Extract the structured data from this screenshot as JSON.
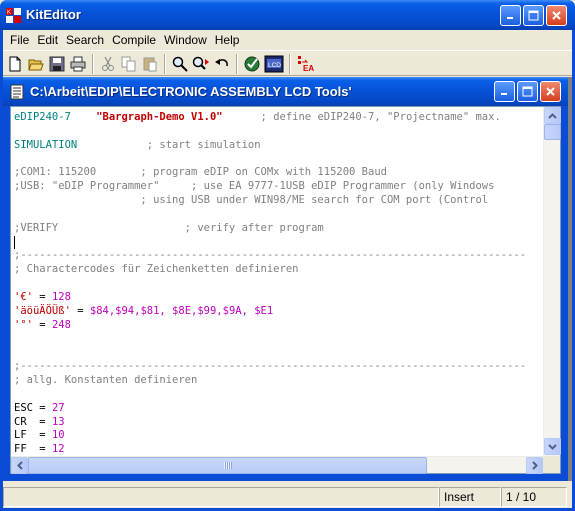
{
  "app": {
    "title": "KitEditor",
    "icon": "kiteditor-app-icon"
  },
  "menu": [
    {
      "label": "File"
    },
    {
      "label": "Edit"
    },
    {
      "label": "Search"
    },
    {
      "label": "Compile"
    },
    {
      "label": "Window"
    },
    {
      "label": "Help"
    }
  ],
  "toolbar": {
    "icons": [
      "new-file-icon",
      "open-folder-icon",
      "save-icon",
      "print-icon",
      "cut-icon",
      "copy-icon",
      "paste-icon",
      "find-icon",
      "replace-icon",
      "undo-icon",
      "compile-icon",
      "lcd-icon",
      "ea-transfer-icon"
    ],
    "lcd_text": "LCD",
    "ea_text": "EA"
  },
  "document": {
    "title": "C:\\Arbeit\\EDIP\\ELECTRONIC ASSEMBLY LCD Tools'",
    "lines": [
      [
        {
          "t": "eDIP240-7    ",
          "c": "#008080"
        },
        {
          "t": "\"Bargraph-Demo V1.0\"",
          "c": "#c00000",
          "b": true
        },
        {
          "t": "      ; define eDIP240-7, \"Projectname\" max.",
          "c": "#808080"
        }
      ],
      [],
      [
        {
          "t": "SIMULATION",
          "c": "#008080"
        },
        {
          "t": "           ; start simulation",
          "c": "#808080"
        }
      ],
      [],
      [
        {
          "t": ";COM1: 115200       ; program eDIP on COMx with 115200 Baud",
          "c": "#808080"
        }
      ],
      [
        {
          "t": ";USB: \"eDIP Programmer\"     ; use EA 9777-1USB eDIP Programmer (only Windows",
          "c": "#808080"
        }
      ],
      [
        {
          "t": "                    ; using USB under WIN98/ME search for COM port (Control",
          "c": "#808080"
        }
      ],
      [],
      [
        {
          "t": ";VERIFY                    ; verify after program",
          "c": "#808080"
        }
      ],
      [
        {
          "caret": true
        }
      ],
      [
        {
          "t": ";--------------------------------------------------------------------------------",
          "c": "#808080"
        }
      ],
      [
        {
          "t": "; Charactercodes für Zeichenketten definieren",
          "c": "#808080"
        }
      ],
      [],
      [
        {
          "t": "'€'",
          "c": "#c00000"
        },
        {
          "t": " = ",
          "c": "#000000"
        },
        {
          "t": "128",
          "c": "#c000c0"
        }
      ],
      [
        {
          "t": "'äöüÄÖÜß'",
          "c": "#c00000"
        },
        {
          "t": " = ",
          "c": "#000000"
        },
        {
          "t": "$84,$94,$81, $8E,$99,$9A, $E1",
          "c": "#c000c0"
        }
      ],
      [
        {
          "t": "'°'",
          "c": "#c00000"
        },
        {
          "t": " = ",
          "c": "#000000"
        },
        {
          "t": "248",
          "c": "#c000c0"
        }
      ],
      [],
      [],
      [
        {
          "t": ";--------------------------------------------------------------------------------",
          "c": "#808080"
        }
      ],
      [
        {
          "t": "; allg. Konstanten definieren",
          "c": "#808080"
        }
      ],
      [],
      [
        {
          "t": "ESC",
          "c": "#000000"
        },
        {
          "t": " = ",
          "c": "#000000"
        },
        {
          "t": "27",
          "c": "#c000c0"
        }
      ],
      [
        {
          "t": "CR",
          "c": "#000000"
        },
        {
          "t": "  = ",
          "c": "#000000"
        },
        {
          "t": "13",
          "c": "#c000c0"
        }
      ],
      [
        {
          "t": "LF",
          "c": "#000000"
        },
        {
          "t": "  = ",
          "c": "#000000"
        },
        {
          "t": "10",
          "c": "#c000c0"
        }
      ],
      [
        {
          "t": "FF",
          "c": "#000000"
        },
        {
          "t": "  = ",
          "c": "#000000"
        },
        {
          "t": "12",
          "c": "#c000c0"
        }
      ]
    ]
  },
  "status": {
    "message": "",
    "mode": "Insert",
    "position": "1 / 10"
  },
  "colors": {
    "titlebar": "#0651d6",
    "comment": "#808080",
    "keyword": "#008080",
    "string": "#c00000",
    "number": "#c000c0"
  }
}
